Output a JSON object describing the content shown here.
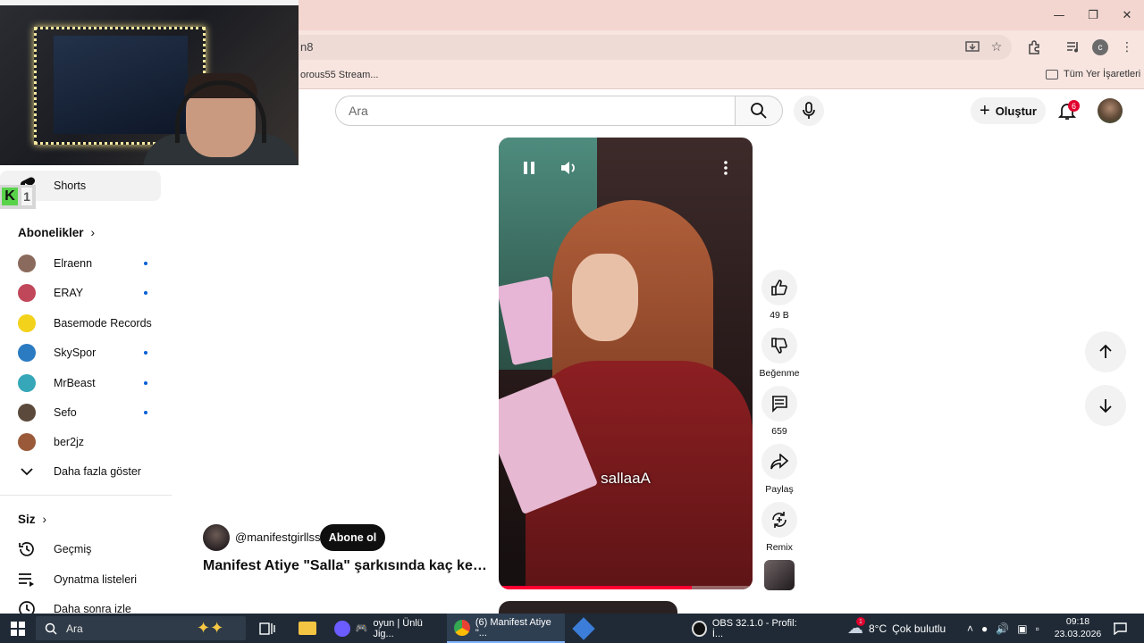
{
  "browser": {
    "address_fragment": "n8",
    "bookmark": "orous55 Stream...",
    "all_bookmarks": "Tüm Yer İşaretleri",
    "profile_initial": "c"
  },
  "masthead": {
    "search_placeholder": "Ara",
    "create_label": "Oluştur",
    "notification_count": "6"
  },
  "sidebar": {
    "shorts_label": "Shorts",
    "subscriptions_heading": "Abonelikler",
    "channels": [
      {
        "name": "Elraenn",
        "new": true,
        "color": "#8a6a5c"
      },
      {
        "name": "ERAY",
        "new": true,
        "color": "#c0475a"
      },
      {
        "name": "Basemode Records",
        "new": false,
        "color": "#f2d21b"
      },
      {
        "name": "SkySpor",
        "new": true,
        "color": "#2b7bc2"
      },
      {
        "name": "MrBeast",
        "new": true,
        "color": "#35a7b8"
      },
      {
        "name": "Sefo",
        "new": true,
        "color": "#5b4a3c"
      },
      {
        "name": "ber2jz",
        "new": false,
        "color": "#9a5a3a"
      }
    ],
    "show_more": "Daha fazla göster",
    "you_heading": "Siz",
    "you_items": [
      {
        "label": "Geçmiş",
        "icon": "history-icon"
      },
      {
        "label": "Oynatma listeleri",
        "icon": "playlist-icon"
      },
      {
        "label": "Daha sonra izle",
        "icon": "watch-later-icon"
      }
    ],
    "overlay_logo": {
      "left": "K",
      "right": "1"
    }
  },
  "short": {
    "caption": "sallaaA",
    "channel_handle": "@manifestgirllss",
    "subscribe_label": "Abone ol",
    "title": "Manifest Atiye \"Salla\" şarkısında kaç kere \"salla\" diyor?",
    "progress_fraction": 0.76,
    "actions": {
      "like_count": "49 B",
      "dislike_label": "Beğenme",
      "comment_count": "659",
      "share_label": "Paylaş",
      "remix_label": "Remix"
    }
  },
  "taskbar": {
    "search_placeholder": "Ara",
    "apps": [
      {
        "label": "oyun | Ünlü Jig...",
        "color": "#6a5cff"
      },
      {
        "label": "(6) Manifest Atiye \"...",
        "color": "#e94235",
        "active": true
      },
      {
        "label": "OBS 32.1.0 - Profil: İ...",
        "color": "#111111"
      }
    ],
    "weather": {
      "temp": "8°C",
      "desc": "Çok bulutlu",
      "alert": "1"
    },
    "time": "09:18",
    "date": "23.03.2026"
  }
}
